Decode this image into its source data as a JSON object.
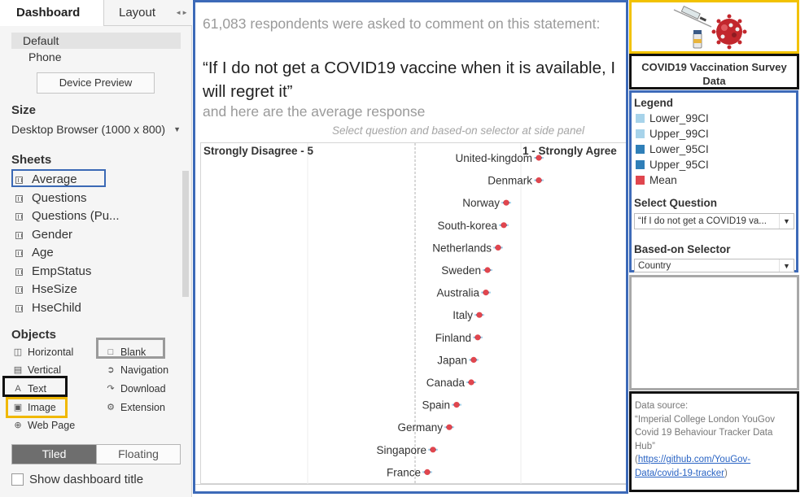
{
  "tabs": {
    "dashboard": "Dashboard",
    "layout": "Layout"
  },
  "device": {
    "items": [
      "Default",
      "Phone"
    ],
    "preview_button": "Device Preview"
  },
  "size": {
    "title": "Size",
    "value": "Desktop Browser (1000 x 800)"
  },
  "sheets": {
    "title": "Sheets",
    "items": [
      "Average",
      "Questions",
      "Questions (Pu...",
      "Gender",
      "Age",
      "EmpStatus",
      "HseSize",
      "HseChild"
    ]
  },
  "objects": {
    "title": "Objects",
    "items": [
      "Horizontal",
      "Blank",
      "Vertical",
      "Navigation",
      "Text",
      "Download",
      "Image",
      "Extension",
      "Web Page"
    ]
  },
  "layout_toggle": {
    "tiled": "Tiled",
    "floating": "Floating"
  },
  "show_title": "Show dashboard title",
  "main": {
    "intro": "61,083 respondents were asked to comment on this statement:",
    "quote": "“If I do not get a COVID19 vaccine when it is available, I will regret it”",
    "after": "and here are the average response",
    "instruction": "Select question and based-on selector at side panel"
  },
  "chart_data": {
    "type": "scatter",
    "left_label": "Strongly Disagree - 5",
    "right_label": "1 - Strongly Agree",
    "categories": [
      "United-kingdom",
      "Denmark",
      "Norway",
      "South-korea",
      "Netherlands",
      "Sweden",
      "Australia",
      "Italy",
      "Finland",
      "Japan",
      "Canada",
      "Spain",
      "Germany",
      "Singapore",
      "France"
    ],
    "series": [
      {
        "name": "Mean",
        "values": [
          1.95,
          1.95,
          2.35,
          2.38,
          2.45,
          2.58,
          2.6,
          2.68,
          2.7,
          2.75,
          2.78,
          2.96,
          3.05,
          3.25,
          3.32
        ]
      }
    ],
    "xlim": [
      5,
      1
    ],
    "colors": {
      "mean": "#e0464e",
      "ci95": "#2f7fb8",
      "ci99": "#a7d3ea"
    }
  },
  "right": {
    "title": "COVID19 Vaccination Survey Data",
    "legend_title": "Legend",
    "legend": [
      {
        "label": "Lower_99CI",
        "color": "#a7d3ea"
      },
      {
        "label": "Upper_99CI",
        "color": "#a7d3ea"
      },
      {
        "label": "Lower_95CI",
        "color": "#2f7fb8"
      },
      {
        "label": "Upper_95CI",
        "color": "#2f7fb8"
      },
      {
        "label": "Mean",
        "color": "#e0464e"
      }
    ],
    "question_label": "Select Question",
    "question_value": "“If I do not get a COVID19 va...",
    "selector_label": "Based-on Selector",
    "selector_value": "Country",
    "source_prefix": "Data source:",
    "source_text": "“Imperial College London YouGov Covid 19 Behaviour Tracker Data Hub”",
    "source_open": "(",
    "source_link": "https://github.com/YouGov-Data/covid-19-tracker",
    "source_close": ")"
  }
}
